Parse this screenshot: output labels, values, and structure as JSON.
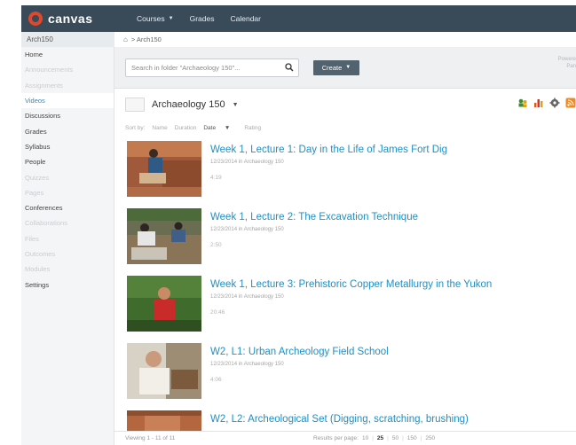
{
  "app": {
    "name": "canvas"
  },
  "topnav": {
    "courses": "Courses",
    "grades": "Grades",
    "calendar": "Calendar"
  },
  "course_code": "Arch150",
  "breadcrumb": {
    "path": "> Arch150"
  },
  "sidebar": {
    "items": [
      {
        "label": "Home",
        "state": "normal"
      },
      {
        "label": "Announcements",
        "state": "muted"
      },
      {
        "label": "Assignments",
        "state": "muted"
      },
      {
        "label": "Videos",
        "state": "active"
      },
      {
        "label": "Discussions",
        "state": "normal"
      },
      {
        "label": "Grades",
        "state": "normal"
      },
      {
        "label": "Syllabus",
        "state": "normal"
      },
      {
        "label": "People",
        "state": "normal"
      },
      {
        "label": "Quizzes",
        "state": "muted"
      },
      {
        "label": "Pages",
        "state": "muted"
      },
      {
        "label": "Conferences",
        "state": "normal"
      },
      {
        "label": "Collaborations",
        "state": "muted"
      },
      {
        "label": "Files",
        "state": "muted"
      },
      {
        "label": "Outcomes",
        "state": "muted"
      },
      {
        "label": "Modules",
        "state": "muted"
      },
      {
        "label": "Settings",
        "state": "normal"
      }
    ]
  },
  "toolbar": {
    "search_placeholder": "Search in folder \"Archaeology 150\"...",
    "create_label": "Create",
    "powered_line1": "Powere",
    "powered_line2": "Pan"
  },
  "folder": {
    "title": "Archaeology 150"
  },
  "sort": {
    "label": "Sort by:",
    "name": "Name",
    "duration": "Duration",
    "date": "Date",
    "rating": "Rating"
  },
  "videos": [
    {
      "title": "Week 1, Lecture 1: Day in the Life of James Fort Dig",
      "meta": "12/23/2014 in Archaeology 150",
      "duration": "4:19"
    },
    {
      "title": "Week 1, Lecture 2: The Excavation Technique",
      "meta": "12/23/2014 in Archaeology 150",
      "duration": "2:50"
    },
    {
      "title": "Week 1, Lecture 3: Prehistoric Copper Metallurgy in the Yukon",
      "meta": "12/23/2014 in Archaeology 150",
      "duration": "20:46"
    },
    {
      "title": "W2, L1: Urban Archeology Field School",
      "meta": "12/23/2014 in Archaeology 150",
      "duration": "4:06"
    },
    {
      "title": "W2, L2: Archeological Set (Digging, scratching, brushing)",
      "meta": "",
      "duration": ""
    }
  ],
  "footer": {
    "viewing": "Viewing 1 - 11 of 11",
    "results_label": "Results per page:",
    "pages": [
      "10",
      "25",
      "50",
      "150",
      "250"
    ]
  }
}
